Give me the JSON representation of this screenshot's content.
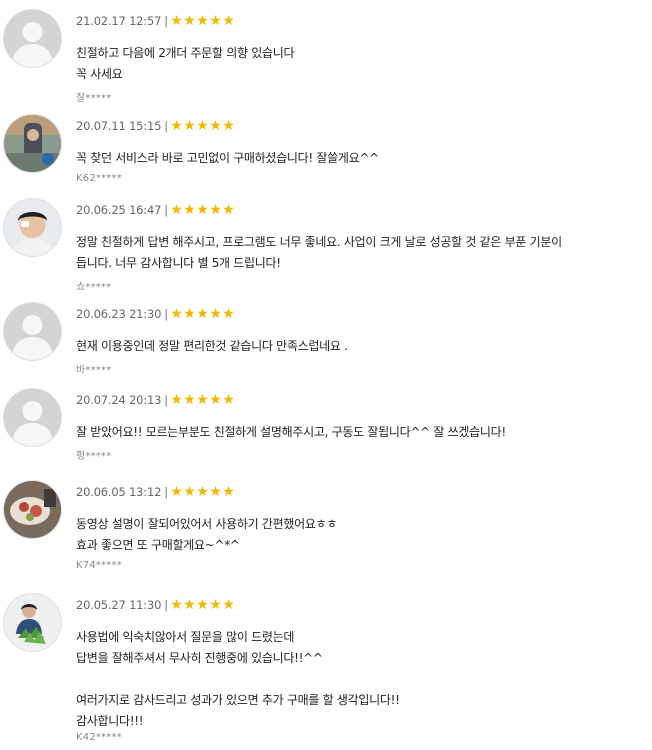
{
  "reviews": [
    {
      "date": "21.02.17 12:57",
      "rating": 5,
      "text": "친절하고 다음에 2개더 주문할 의향 있습니다\n꼭 사세요",
      "author": "잘*****",
      "avatar": "default-avatar"
    },
    {
      "date": "20.07.11 15:15",
      "rating": 5,
      "text": "꼭 찾던 서비스라 바로 고민없이 구매하셨습니다! 잘쓸게요^^",
      "author": "K62*****",
      "avatar": "photo-avatar"
    },
    {
      "date": "20.06.25 16:47",
      "rating": 5,
      "text": "정말 친절하게 답변 해주시고, 프로그램도 너무 좋네요. 사업이 크게 날로 성공할 것 같은 부푼 기분이\n듭니다. 너무 감사합니다 별 5개 드립니다!",
      "author": "쇼*****",
      "avatar": "photo-avatar"
    },
    {
      "date": "20.06.23 21:30",
      "rating": 5,
      "text": "현재 이용중인데 정말 편리한것 같습니다 만족스럽네요 .",
      "author": "바*****",
      "avatar": "default-avatar"
    },
    {
      "date": "20.07.24 20:13",
      "rating": 5,
      "text": "잘 받았어요!! 모르는부분도 친절하게 설명해주시고, 구동도 잘됩니다^^ 잘 쓰겠습니다!",
      "author": "펑*****",
      "avatar": "default-avatar"
    },
    {
      "date": "20.06.05 13:12",
      "rating": 5,
      "text": "동영상 설명이 잘되어있어서 사용하기 간편했어요ㅎㅎ\n효과 좋으면 또 구매할게요~^*^",
      "author": "K74*****",
      "avatar": "photo-avatar"
    },
    {
      "date": "20.05.27 11:30",
      "rating": 5,
      "text": "사용법에 익숙치않아서 질문을 많이 드렸는데\n답변을 잘해주셔서 무사히 진행중에 있습니다!!^^\n\n여러가지로 감사드리고 성과가 있으면 추가 구매를 할 생각입니다!!\n감사합니다!!!",
      "author": "K42*****",
      "avatar": "photo-avatar"
    }
  ],
  "colors": {
    "star": "#f5b800",
    "text": "#222222",
    "meta": "#666666",
    "author": "#888888"
  },
  "icons": {
    "rating": "star-icon",
    "separator": "|"
  }
}
